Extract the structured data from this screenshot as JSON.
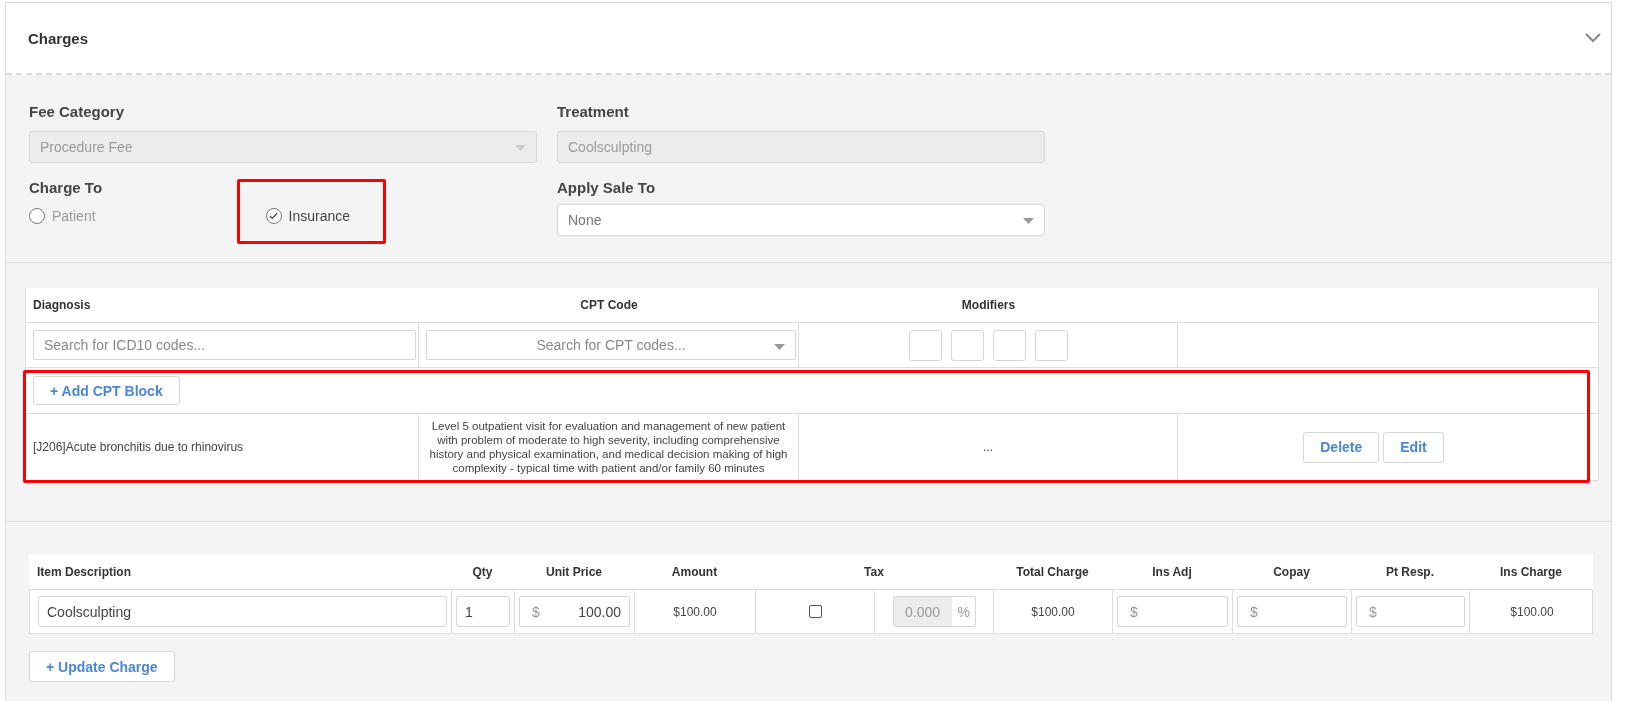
{
  "panel": {
    "title": "Charges",
    "expanded": true
  },
  "fee_category": {
    "label": "Fee Category",
    "value": "Procedure Fee",
    "disabled": true
  },
  "treatment": {
    "label": "Treatment",
    "value": "Coolsculpting",
    "disabled": true
  },
  "charge_to": {
    "label": "Charge To",
    "options": [
      {
        "label": "Patient",
        "selected": false,
        "highlighted": false
      },
      {
        "label": "Insurance",
        "selected": true,
        "highlighted": true
      }
    ]
  },
  "apply_sale_to": {
    "label": "Apply Sale To",
    "value": "None"
  },
  "cpt_table": {
    "columns": [
      "Diagnosis",
      "CPT Code",
      "Modifiers"
    ],
    "diagnosis_search": {
      "placeholder": "Search for ICD10 codes..."
    },
    "cpt_search": {
      "placeholder": "Search for CPT codes..."
    },
    "add_button": "+ Add CPT Block",
    "highlighted": true,
    "rows": [
      {
        "diagnosis": "[J206]Acute bronchitis due to rhinovirus",
        "cpt_description": "Level 5 outpatient visit for evaluation and management of new patient with problem of moderate to high severity, including comprehensive history and physical examination, and medical decision making of high complexity - typical time with patient and/or family 60 minutes",
        "modifiers": "...",
        "actions": [
          "Delete",
          "Edit"
        ]
      }
    ]
  },
  "charge_table": {
    "columns": [
      "Item Description",
      "Qty",
      "Unit Price",
      "Amount",
      "Tax",
      "Total Charge",
      "Ins Adj",
      "Copay",
      "Pt Resp.",
      "Ins Charge"
    ],
    "rows": [
      {
        "description": "Coolsculpting",
        "qty": "1",
        "unit_price": {
          "prefix": "$",
          "value": "100.00"
        },
        "amount": "$100.00",
        "taxable": false,
        "tax_rate": {
          "value": "0.000",
          "suffix": "%"
        },
        "total_charge": "$100.00",
        "ins_adj": {
          "prefix": "$"
        },
        "copay": {
          "prefix": "$"
        },
        "pt_resp": {
          "prefix": "$"
        },
        "ins_charge": "$100.00"
      }
    ]
  },
  "update_button": "+ Update Charge"
}
